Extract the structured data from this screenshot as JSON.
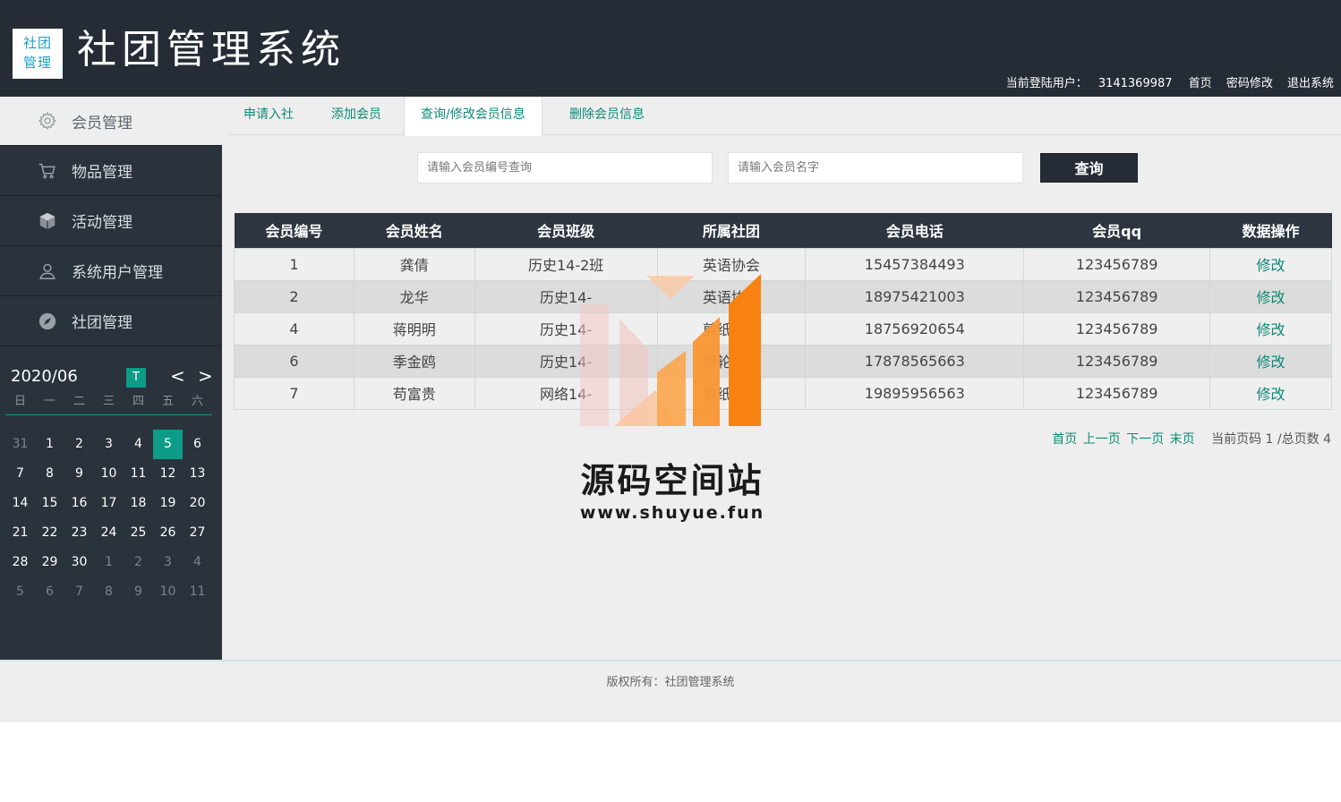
{
  "header": {
    "logo_text": "社团\n管理",
    "title": "社团管理系统",
    "current_user_label": "当前登陆用户：",
    "current_user_id": "3141369987",
    "links": [
      "首页",
      "密码修改",
      "退出系统"
    ]
  },
  "sidebar": {
    "items": [
      {
        "label": "会员管理",
        "icon": "gear-icon",
        "active": true
      },
      {
        "label": "物品管理",
        "icon": "cart-icon",
        "active": false
      },
      {
        "label": "活动管理",
        "icon": "cube-icon",
        "active": false
      },
      {
        "label": "系统用户管理",
        "icon": "user-icon",
        "active": false
      },
      {
        "label": "社团管理",
        "icon": "compass-icon",
        "active": false
      }
    ]
  },
  "calendar": {
    "month": "2020/06",
    "today_label": "T",
    "prev": "<",
    "next": ">",
    "weekdays": [
      "日",
      "一",
      "二",
      "三",
      "四",
      "五",
      "六"
    ],
    "days": [
      [
        "31",
        "muted"
      ],
      [
        "1",
        ""
      ],
      [
        "2",
        ""
      ],
      [
        "3",
        ""
      ],
      [
        "4",
        ""
      ],
      [
        "5",
        "sel"
      ],
      [
        "6",
        ""
      ],
      [
        "7",
        ""
      ],
      [
        "8",
        ""
      ],
      [
        "9",
        ""
      ],
      [
        "10",
        ""
      ],
      [
        "11",
        ""
      ],
      [
        "12",
        ""
      ],
      [
        "13",
        ""
      ],
      [
        "14",
        ""
      ],
      [
        "15",
        ""
      ],
      [
        "16",
        ""
      ],
      [
        "17",
        ""
      ],
      [
        "18",
        ""
      ],
      [
        "19",
        ""
      ],
      [
        "20",
        ""
      ],
      [
        "21",
        ""
      ],
      [
        "22",
        ""
      ],
      [
        "23",
        ""
      ],
      [
        "24",
        ""
      ],
      [
        "25",
        ""
      ],
      [
        "26",
        ""
      ],
      [
        "27",
        ""
      ],
      [
        "28",
        ""
      ],
      [
        "29",
        ""
      ],
      [
        "30",
        ""
      ],
      [
        "1",
        "muted"
      ],
      [
        "2",
        "muted"
      ],
      [
        "3",
        "muted"
      ],
      [
        "4",
        "muted"
      ],
      [
        "5",
        "muted"
      ],
      [
        "6",
        "muted"
      ],
      [
        "7",
        "muted"
      ],
      [
        "8",
        "muted"
      ],
      [
        "9",
        "muted"
      ],
      [
        "10",
        "muted"
      ],
      [
        "11",
        "muted"
      ]
    ]
  },
  "tabs": [
    {
      "label": "申请入社",
      "active": false
    },
    {
      "label": "添加会员",
      "active": false
    },
    {
      "label": "查询/修改会员信息",
      "active": true
    },
    {
      "label": "删除会员信息",
      "active": false
    }
  ],
  "search": {
    "id_placeholder": "请输入会员编号查询",
    "name_placeholder": "请输入会员名字",
    "button": "查询"
  },
  "table": {
    "columns": [
      "会员编号",
      "会员姓名",
      "会员班级",
      "所属社团",
      "会员电话",
      "会员qq",
      "数据操作"
    ],
    "rows": [
      [
        "1",
        "龚倩",
        "历史14-2班",
        "英语协会",
        "15457384493",
        "123456789",
        "修改"
      ],
      [
        "2",
        "龙华",
        "历史14-",
        "英语协会",
        "18975421003",
        "123456789",
        "修改"
      ],
      [
        "4",
        "蒋明明",
        "历史14-",
        "剪纸协会",
        "18756920654",
        "123456789",
        "修改"
      ],
      [
        "6",
        "季金鸥",
        "历史14-",
        "滑轮协会",
        "17878565663",
        "123456789",
        "修改"
      ],
      [
        "7",
        "苟富贵",
        "网络14-",
        "剪纸协会",
        "19895956563",
        "123456789",
        "修改"
      ]
    ]
  },
  "pager": {
    "first": "首页",
    "prev": "上一页",
    "next": "下一页",
    "last": "末页",
    "info": "当前页码 1 /总页数 4"
  },
  "watermark": {
    "title": "源码空间站",
    "url": "www.shuyue.fun"
  },
  "footer": {
    "copyright": "版权所有：社团管理系统"
  },
  "colors": {
    "header_bg": "#252c36",
    "accent": "#0e9b87",
    "link": "#0e8a78"
  }
}
